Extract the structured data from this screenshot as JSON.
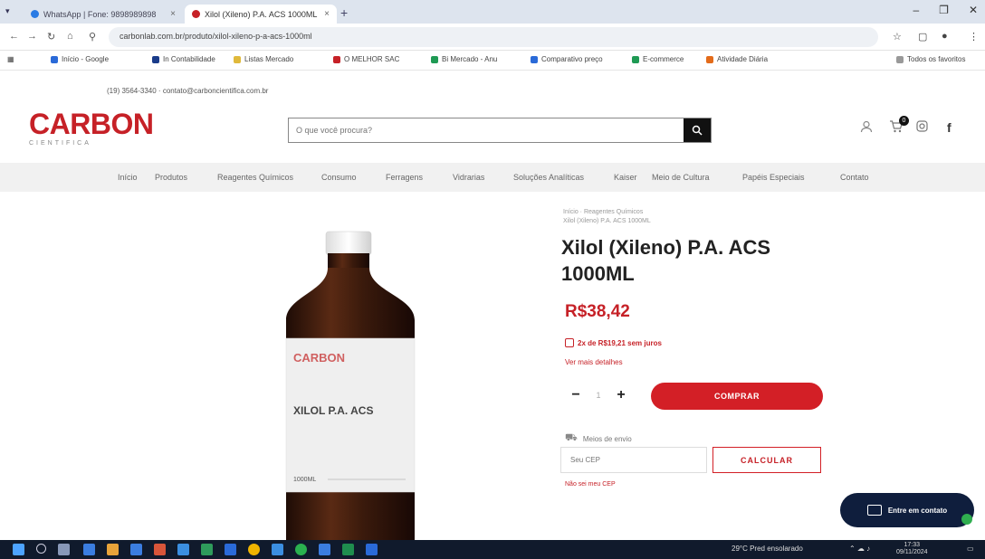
{
  "browser": {
    "tab_inactive_title": "WhatsApp | Fone: 9898989898",
    "tab_active_title": "Xilol (Xileno) P.A. ACS 1000ML",
    "url": "carbonlab.com.br/produto/xilol-xileno-p-a-acs-1000ml"
  },
  "bookmarks": [
    "Início - Google",
    "In Contabilidade",
    "Listas Mercado",
    "O MELHOR SAC",
    "Bi Mercado - Anu",
    "Comparativo preço",
    "E-commerce",
    "Atividade Diária"
  ],
  "bookmarks_right": "Todos os favoritos",
  "site": {
    "contact_line": "(19) 3564-3340 · contato@carboncientifica.com.br",
    "logo_name": "CARBON",
    "logo_tagline": "CIENTIFICA",
    "search_placeholder": "O que você procura?",
    "cart_count": "0",
    "nav": [
      "Início",
      "Produtos",
      "Reagentes Químicos",
      "Consumo",
      "Ferragens",
      "Vidrarias",
      "Soluções Analíticas",
      "Kaiser",
      "Meio de Cultura",
      "Papéis Especiais",
      "Contato"
    ]
  },
  "product": {
    "breadcrumb": "Início · Reagentes Químicos",
    "breadcrumb_current": "Xilol (Xileno) P.A. ACS 1000ML",
    "title": "Xilol (Xileno) P.A. ACS 1000ML",
    "price": "R$38,42",
    "installments": "2x de R$19,21 sem juros",
    "more_info": "Ver mais detalhes",
    "qty": "1",
    "qty_minus": "−",
    "qty_plus": "+",
    "buy_label": "COMPRAR",
    "shipping_label": "Meios de envio",
    "cep_placeholder": "Seu CEP",
    "calc_label": "CALCULAR",
    "no_cep": "Não sei meu CEP",
    "label_brand": "CARBON",
    "label_text": "XILOL P.A. ACS",
    "label_size": "1000ML"
  },
  "chat": {
    "label": "Entre em contato"
  },
  "taskbar": {
    "weather": "29°C Pred ensolarado",
    "time": "17:33",
    "date": "09/11/2024"
  },
  "colors": {
    "brand_red": "#c62127",
    "button_red": "#d31f26",
    "navy": "#0f1e3d"
  }
}
